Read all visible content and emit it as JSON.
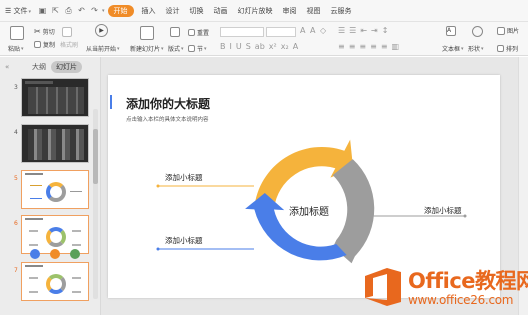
{
  "menu": {
    "file": "文件",
    "items": [
      "开始",
      "插入",
      "设计",
      "切换",
      "动画",
      "幻灯片放映",
      "审阅",
      "视图",
      "云服务"
    ]
  },
  "ribbon": {
    "paste": "粘贴",
    "cut": "剪切",
    "copy": "复制",
    "format_painter": "格式刷",
    "start_from": "从当前开始",
    "new_slide": "新建幻灯片",
    "layout": "版式",
    "section": "节",
    "reset": "重置",
    "textbox": "文本框",
    "shape": "形状",
    "arrange": "排列",
    "picture": "图片"
  },
  "side": {
    "tab_outline": "大纲",
    "tab_slides": "幻灯片",
    "slide_numbers": [
      "3",
      "4",
      "5",
      "6",
      "7"
    ]
  },
  "slide": {
    "title": "添加你的大标题",
    "subtitle": "点击输入本栏的具体文本说明内容",
    "center_label": "添加标题",
    "label_top_left": "添加小标题",
    "label_bottom_left": "添加小标题",
    "label_right": "添加小标题"
  },
  "chart_colors": {
    "top": "#f5b33c",
    "right": "#9d9d9d",
    "bottom": "#4a7ee8"
  },
  "watermark": {
    "brand": "Office教程网",
    "url": "www.office26.com"
  }
}
